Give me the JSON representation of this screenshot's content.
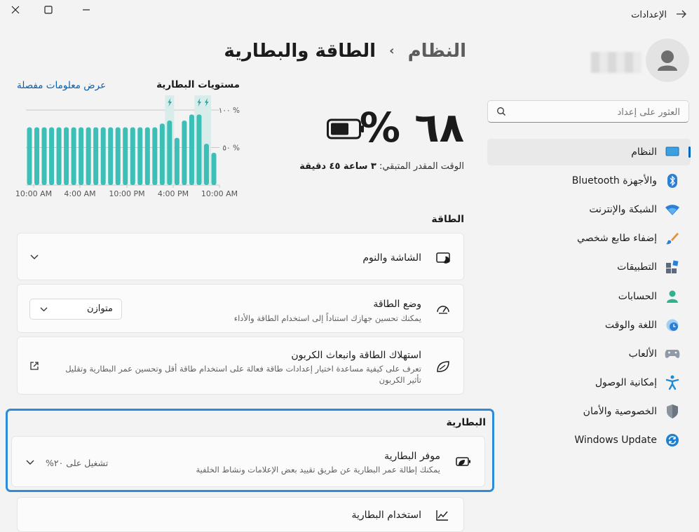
{
  "window": {
    "title": "الإعدادات",
    "back_icon": "arrow-right-icon",
    "close_icon": "close-icon",
    "maximize_icon": "maximize-icon",
    "minimize_icon": "minimize-icon"
  },
  "header": {
    "breadcrumb_parent": "النظام",
    "breadcrumb_separator": "›",
    "breadcrumb_current": "الطاقة والبطارية"
  },
  "search": {
    "placeholder": "العثور على إعداد"
  },
  "nav": {
    "items": [
      {
        "label": "النظام",
        "icon": "system-display-icon",
        "active": true
      },
      {
        "label": "Bluetooth والأجهزة",
        "icon": "bluetooth-icon"
      },
      {
        "label": "الشبكة والإنترنت",
        "icon": "wifi-icon"
      },
      {
        "label": "إضفاء طابع شخصي",
        "icon": "paintbrush-icon"
      },
      {
        "label": "التطبيقات",
        "icon": "apps-icon"
      },
      {
        "label": "الحسابات",
        "icon": "account-icon"
      },
      {
        "label": "اللغة والوقت",
        "icon": "globe-clock-icon"
      },
      {
        "label": "الألعاب",
        "icon": "gamepad-icon"
      },
      {
        "label": "إمكانية الوصول",
        "icon": "accessibility-icon"
      },
      {
        "label": "الخصوصية والأمان",
        "icon": "shield-icon"
      },
      {
        "label": "Windows Update",
        "icon": "windows-update-icon"
      }
    ]
  },
  "battery": {
    "percent_text": "٦٨ %",
    "percent_value": 68,
    "remaining_label": "الوقت المقدر المتبقي:",
    "remaining_value": "٣ ساعة ٤٥ دقيقة"
  },
  "chart_data": {
    "type": "bar",
    "title": "مستويات البطارية",
    "link": "عرض معلومات مفصلة",
    "y_ticks": [
      "١٠٠ %",
      "٥٠ %"
    ],
    "ylim": [
      0,
      100
    ],
    "x_ticks": [
      "10:00 AM",
      "4:00 AM",
      "10:00 PM",
      "4:00 PM",
      "10:00 AM"
    ],
    "values": [
      77,
      77,
      77,
      77,
      77,
      77,
      77,
      77,
      77,
      77,
      77,
      77,
      77,
      77,
      77,
      77,
      77,
      77,
      82,
      86,
      63,
      86,
      94,
      94,
      55,
      43
    ],
    "charging_indices": [
      19,
      23,
      24
    ],
    "color": "#3bbfb6",
    "charging_bg": "#d8ecea"
  },
  "power": {
    "section_title": "الطاقة",
    "screen_sleep": {
      "title": "الشاشة والنوم"
    },
    "power_mode": {
      "title": "وضع الطاقة",
      "subtitle": "يمكنك تحسين جهازك استناداً إلى استخدام الطاقة والأداء",
      "value": "متوازن"
    },
    "carbon": {
      "title": "استهلاك الطاقة وانبعاث الكربون",
      "subtitle_line1": "تعرف على كيفية مساعدة اختيار إعدادات طاقة فعالة على استخدام طاقة أقل وتحسين عمر البطارية وتقليل",
      "subtitle_line2": "تأثير الكربون"
    }
  },
  "battery_section": {
    "section_title": "البطارية",
    "saver": {
      "title": "موفر البطارية",
      "subtitle": "يمكنك إطالة عمر البطارية عن طريق تقييد بعض الإعلامات ونشاط الخلفية",
      "status": "تشغيل على ٢٠%"
    },
    "usage": {
      "title": "استخدام البطارية"
    }
  },
  "colors": {
    "accent": "#0067c0",
    "highlight_border": "#2f8ad8",
    "chart_bar": "#3bbfb6"
  }
}
